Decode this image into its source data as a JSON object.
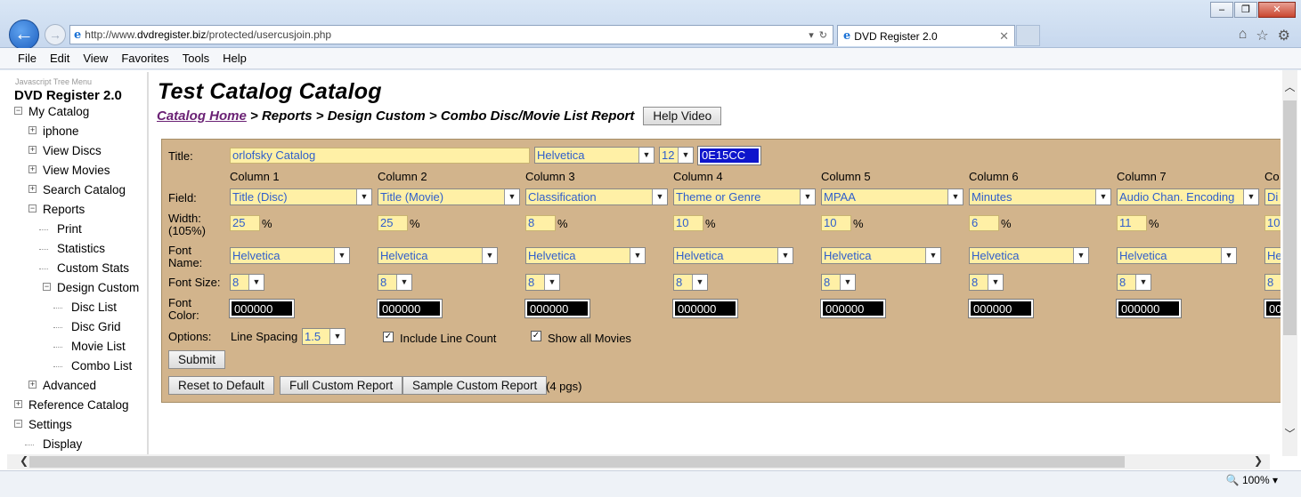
{
  "browser": {
    "url_prefix": "http://www.",
    "url_domain": "dvdregister.biz",
    "url_path": "/protected/usercusjoin.php",
    "tab_title": "DVD Register 2.0",
    "zoom": "100%"
  },
  "menu": [
    "File",
    "Edit",
    "View",
    "Favorites",
    "Tools",
    "Help"
  ],
  "sidebar": {
    "caption": "Javascript Tree Menu",
    "title": "DVD Register 2.0",
    "items": [
      {
        "label": "My Catalog",
        "indent": 0,
        "box": "⊟"
      },
      {
        "label": "iphone",
        "indent": 1,
        "box": "⊞"
      },
      {
        "label": "View Discs",
        "indent": 1,
        "box": "⊞"
      },
      {
        "label": "View Movies",
        "indent": 1,
        "box": "⊞"
      },
      {
        "label": "Search Catalog",
        "indent": 1,
        "box": "⊞"
      },
      {
        "label": "Reports",
        "indent": 1,
        "box": "⊟"
      },
      {
        "label": "Print",
        "indent": 2,
        "box": ""
      },
      {
        "label": "Statistics",
        "indent": 2,
        "box": ""
      },
      {
        "label": "Custom Stats",
        "indent": 2,
        "box": ""
      },
      {
        "label": "Design Custom",
        "indent": 2,
        "box": "⊟"
      },
      {
        "label": "Disc List",
        "indent": 3,
        "box": ""
      },
      {
        "label": "Disc Grid",
        "indent": 3,
        "box": ""
      },
      {
        "label": "Movie List",
        "indent": 3,
        "box": ""
      },
      {
        "label": "Combo List",
        "indent": 3,
        "box": ""
      },
      {
        "label": "Advanced",
        "indent": 1,
        "box": "⊞"
      },
      {
        "label": "Reference Catalog",
        "indent": 0,
        "box": "⊞"
      },
      {
        "label": "Settings",
        "indent": 0,
        "box": "⊟"
      },
      {
        "label": "Display",
        "indent": 1,
        "box": ""
      }
    ]
  },
  "page": {
    "title": "Test Catalog Catalog",
    "crumb_home": "Catalog Home",
    "crumb_rest": " > Reports > Design Custom > Combo Disc/Movie List Report",
    "help_button": "Help Video"
  },
  "form": {
    "title_label": "Title:",
    "title_value": "orlofsky Catalog",
    "title_font": "Helvetica",
    "title_size": "12",
    "title_color": "0E15CC",
    "field_label": "Field:",
    "width_label": "Width:",
    "width_note": "(105%)",
    "font_name_label": "Font",
    "font_name_label2": "Name:",
    "font_size_label": "Font Size:",
    "font_color_label": "Font",
    "font_color_label2": "Color:",
    "options_label": "Options:",
    "line_spacing_label": "Line Spacing",
    "line_spacing_value": "1.5",
    "include_line_count": "Include Line Count",
    "show_all_movies": "Show all Movies",
    "percent": "%",
    "columns": [
      {
        "header": "Column 1",
        "field": "Title (Disc)",
        "width": "25",
        "font": "Helvetica",
        "size": "8",
        "color": "000000"
      },
      {
        "header": "Column 2",
        "field": "Title (Movie)",
        "width": "25",
        "font": "Helvetica",
        "size": "8",
        "color": "000000"
      },
      {
        "header": "Column 3",
        "field": "Classification",
        "width": "8",
        "font": "Helvetica",
        "size": "8",
        "color": "000000"
      },
      {
        "header": "Column 4",
        "field": "Theme or Genre",
        "width": "10",
        "font": "Helvetica",
        "size": "8",
        "color": "000000"
      },
      {
        "header": "Column 5",
        "field": "MPAA",
        "width": "10",
        "font": "Helvetica",
        "size": "8",
        "color": "000000"
      },
      {
        "header": "Column 6",
        "field": "Minutes",
        "width": "6",
        "font": "Helvetica",
        "size": "8",
        "color": "000000"
      },
      {
        "header": "Column 7",
        "field": "Audio Chan. Encoding",
        "width": "11",
        "font": "Helvetica",
        "size": "8",
        "color": "000000"
      },
      {
        "header": "Co",
        "field": "Di",
        "width": "10",
        "font": "He",
        "size": "8",
        "color": "00"
      }
    ],
    "submit": "Submit",
    "reset": "Reset to Default",
    "full_report": "Full Custom Report",
    "sample_report": "Sample Custom Report",
    "sample_pages": "(4 pgs)"
  }
}
